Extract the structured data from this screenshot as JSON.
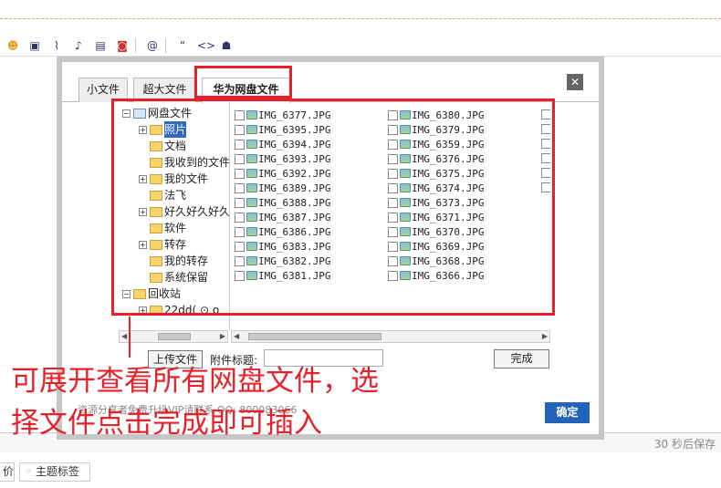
{
  "editor": {
    "toolbar_icons": [
      "emoji-icon",
      "image-icon",
      "attachment-icon",
      "music-icon",
      "video-icon",
      "flash-icon",
      "at-icon",
      "quote-icon",
      "code-icon",
      "qq-icon"
    ],
    "autosave": "30 秒后保存",
    "bottom_buttons": [
      "价",
      "主题标签"
    ]
  },
  "dialog": {
    "tabs": [
      "小文件",
      "超大文件",
      "华为网盘文件"
    ],
    "close": "✕",
    "tree": [
      {
        "label": "网盘文件",
        "depth": 0,
        "exp": "−",
        "icon": "disk"
      },
      {
        "label": "照片",
        "depth": 1,
        "exp": "+",
        "icon": "folder"
      },
      {
        "label": "文档",
        "depth": 1,
        "exp": "",
        "icon": "folder"
      },
      {
        "label": "我收到的文件",
        "depth": 1,
        "exp": "",
        "icon": "folder"
      },
      {
        "label": "我的文件",
        "depth": 1,
        "exp": "+",
        "icon": "user"
      },
      {
        "label": "法飞",
        "depth": 1,
        "exp": "",
        "icon": "folder"
      },
      {
        "label": "好久好久好久",
        "depth": 1,
        "exp": "+",
        "icon": "folder"
      },
      {
        "label": "软件",
        "depth": 1,
        "exp": "",
        "icon": "folder"
      },
      {
        "label": "转存",
        "depth": 1,
        "exp": "+",
        "icon": "folder"
      },
      {
        "label": "我的转存",
        "depth": 1,
        "exp": "",
        "icon": "folder"
      },
      {
        "label": "系统保留",
        "depth": 1,
        "exp": "",
        "icon": "folder"
      },
      {
        "label": "回收站",
        "depth": 0,
        "exp": "−",
        "icon": "folder"
      },
      {
        "label": "22dd( ⊙ o",
        "depth": 1,
        "exp": "+",
        "icon": "folder"
      }
    ],
    "files_col1": [
      "IMG_6377.JPG",
      "IMG_6395.JPG",
      "IMG_6394.JPG",
      "IMG_6393.JPG",
      "IMG_6392.JPG",
      "IMG_6389.JPG",
      "IMG_6388.JPG",
      "IMG_6387.JPG",
      "IMG_6386.JPG",
      "IMG_6383.JPG",
      "IMG_6382.JPG",
      "IMG_6381.JPG"
    ],
    "files_col2": [
      "IMG_6380.JPG",
      "IMG_6379.JPG",
      "IMG_6359.JPG",
      "IMG_6376.JPG",
      "IMG_6375.JPG",
      "IMG_6374.JPG",
      "IMG_6373.JPG",
      "IMG_6371.JPG",
      "IMG_6370.JPG",
      "IMG_6369.JPG",
      "IMG_6368.JPG",
      "IMG_6366.JPG"
    ],
    "upload_label": "上传文件",
    "attach_title_label": "附件标题:",
    "attach_title_value": "",
    "done_label": "完成",
    "footer_note": "资源分享者免费升级VIP请联系 QQ: 800083066",
    "ok_label": "确定"
  },
  "annotation": {
    "line1": "可展开查看所有网盘文件，选",
    "line2": "择文件点击完成即可插入",
    "color": "#e8202a"
  }
}
